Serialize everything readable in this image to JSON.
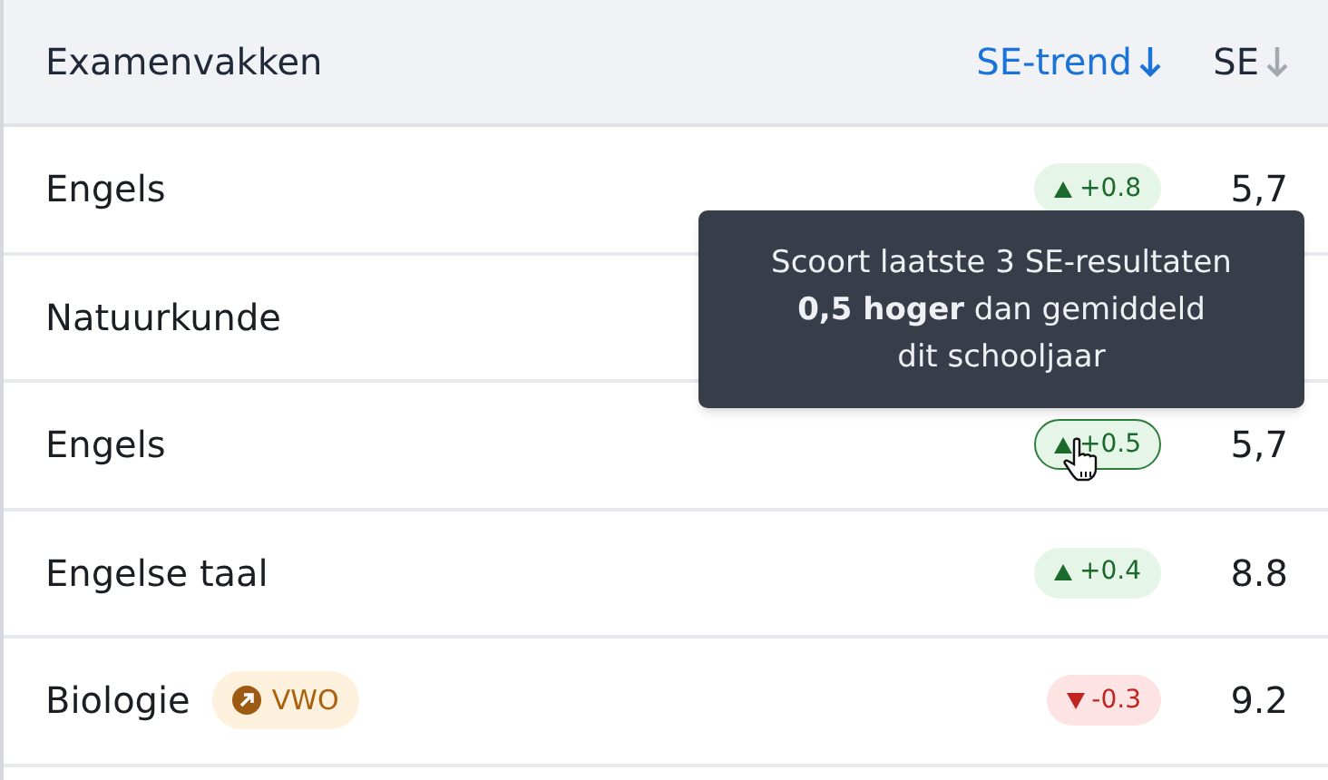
{
  "table": {
    "columns": [
      {
        "label": "Examenvakken",
        "sortable": false,
        "sorted": false
      },
      {
        "label": "SE-trend",
        "sortable": true,
        "sorted": true
      },
      {
        "label": "SE",
        "sortable": true,
        "sorted": false
      }
    ],
    "rows": [
      {
        "subject": "Engels",
        "trend": {
          "kind": "up",
          "value": "+0.8",
          "hovered": false
        },
        "se": "5,7"
      },
      {
        "subject": "Natuurkunde"
      },
      {
        "subject": "Engels",
        "trend": {
          "kind": "up",
          "value": "+0.5",
          "hovered": true
        },
        "se": "5,7"
      },
      {
        "subject": "Engelse taal",
        "trend": {
          "kind": "up",
          "value": "+0.4",
          "hovered": false
        },
        "se": "8.8"
      },
      {
        "subject": "Biologie",
        "badge": "VWO",
        "trend": {
          "kind": "down",
          "value": "-0.3",
          "hovered": false
        },
        "se": "9.2"
      }
    ]
  },
  "tooltip": {
    "lines": [
      "Scoort laatste 3 SE-resultaten",
      "**0,5 hoger** dan gemiddeld",
      "dit schooljaar"
    ]
  }
}
